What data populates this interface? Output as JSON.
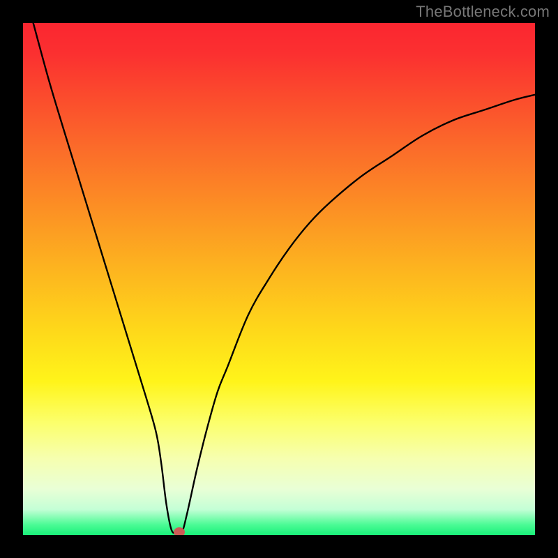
{
  "watermark": "TheBottleneck.com",
  "chart_data": {
    "type": "line",
    "title": "",
    "xlabel": "",
    "ylabel": "",
    "xlim": [
      0,
      100
    ],
    "ylim": [
      0,
      100
    ],
    "grid": false,
    "legend": false,
    "background": "rainbow-gradient",
    "series": [
      {
        "name": "bottleneck-curve",
        "x": [
          2,
          5,
          8,
          12,
          16,
          20,
          24,
          26,
          27,
          28,
          29,
          30,
          31,
          32,
          34,
          36,
          38,
          40,
          44,
          48,
          52,
          56,
          60,
          66,
          72,
          78,
          84,
          90,
          96,
          100
        ],
        "y": [
          100,
          89,
          79,
          66,
          53,
          40,
          27,
          20,
          14,
          6,
          1,
          0.5,
          0.5,
          4,
          13,
          21,
          28,
          33,
          43,
          50,
          56,
          61,
          65,
          70,
          74,
          78,
          81,
          83,
          85,
          86
        ]
      }
    ],
    "marker": {
      "x": 30.5,
      "y": 0.5,
      "color": "#cd5b56"
    }
  },
  "colors": {
    "frame": "#000000",
    "curve": "#000000",
    "marker": "#cd5b56",
    "watermark": "#777777"
  }
}
